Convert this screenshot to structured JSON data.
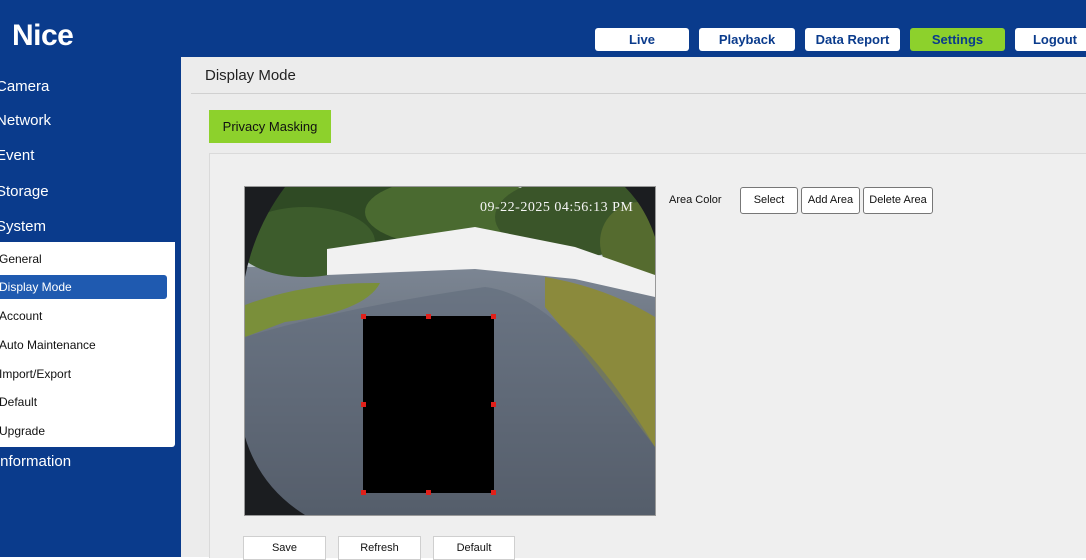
{
  "brand": {
    "logo_text": "Nice",
    "primary_color": "#0a3b8c",
    "accent_color": "#8dd12c"
  },
  "topnav": {
    "live": "Live",
    "playback": "Playback",
    "data_report": "Data Report",
    "settings": "Settings",
    "logout": "Logout"
  },
  "sidebar": {
    "camera": "Camera",
    "network": "Network",
    "event": "Event",
    "storage": "Storage",
    "system": "System",
    "information": "Information",
    "system_sub": {
      "general": "General",
      "display_mode": "Display Mode",
      "account": "Account",
      "auto_maintenance": "Auto Maintenance",
      "import_export": "Import/Export",
      "default": "Default",
      "upgrade": "Upgrade"
    }
  },
  "main": {
    "title": "Display Mode",
    "tab": "Privacy Masking",
    "preview": {
      "timestamp": "09-22-2025 04:56:13 PM"
    },
    "area_color_label": "Area Color",
    "buttons": {
      "select": "Select",
      "add_area": "Add Area",
      "delete_area": "Delete Area",
      "save": "Save",
      "refresh": "Refresh",
      "default": "Default"
    }
  }
}
